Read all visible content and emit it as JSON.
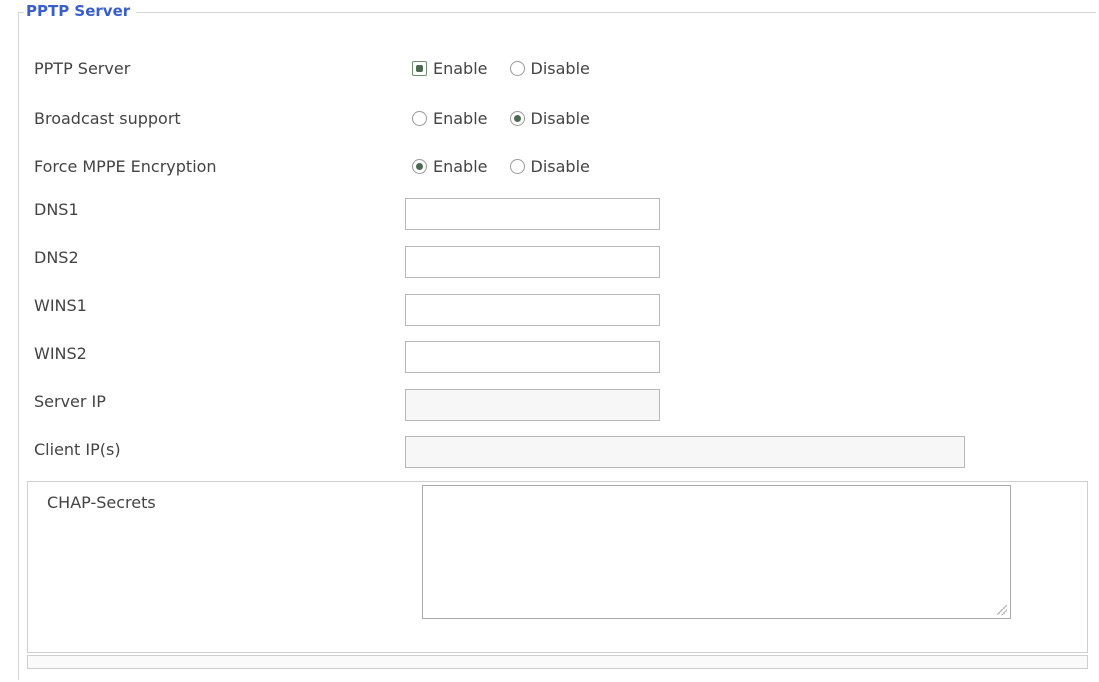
{
  "section": {
    "title": "PPTP Server"
  },
  "fields": {
    "pptp_server": {
      "label": "PPTP Server",
      "enable": "Enable",
      "disable": "Disable",
      "selected": "Enable"
    },
    "broadcast_support": {
      "label": "Broadcast support",
      "enable": "Enable",
      "disable": "Disable",
      "selected": "Disable"
    },
    "force_mppe": {
      "label": "Force MPPE Encryption",
      "enable": "Enable",
      "disable": "Disable",
      "selected": "Enable"
    },
    "dns1": {
      "label": "DNS1",
      "value": ""
    },
    "dns2": {
      "label": "DNS2",
      "value": ""
    },
    "wins1": {
      "label": "WINS1",
      "value": ""
    },
    "wins2": {
      "label": "WINS2",
      "value": ""
    },
    "server_ip": {
      "label": "Server IP",
      "value": ""
    },
    "client_ips": {
      "label": "Client IP(s)",
      "value": ""
    },
    "chap_secrets": {
      "label": "CHAP-Secrets",
      "value": ""
    }
  },
  "icons": [
    "radio-icon",
    "resize-grip-icon"
  ],
  "colors": {
    "legend": "#3a5fcd",
    "radio_dot": "#4c6a52"
  }
}
